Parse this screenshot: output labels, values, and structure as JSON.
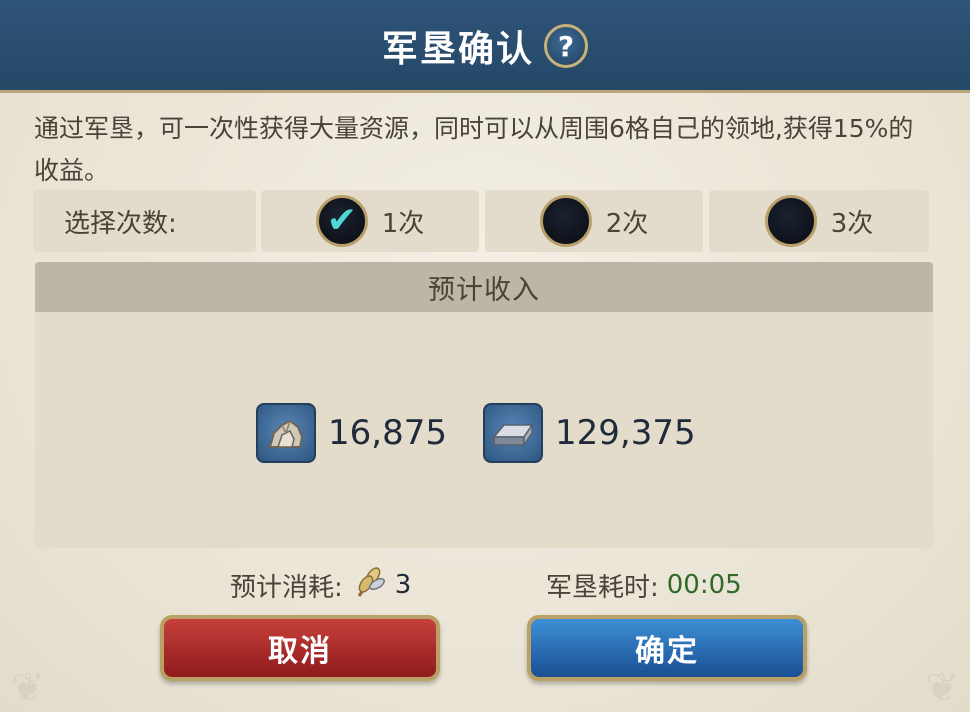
{
  "dialog": {
    "title": "军垦确认",
    "help_glyph": "?",
    "description": "通过军垦，可一次性获得大量资源，同时可以从周围6格自己的领地,获得15%的收益。"
  },
  "selection": {
    "label": "选择次数:",
    "options": [
      {
        "label": "1次",
        "selected": true
      },
      {
        "label": "2次",
        "selected": false
      },
      {
        "label": "3次",
        "selected": false
      }
    ],
    "check_glyph": "✔"
  },
  "income": {
    "header": "预计收入",
    "resources": [
      {
        "icon": "stone-icon",
        "value": "16,875"
      },
      {
        "icon": "iron-ingot-icon",
        "value": "129,375"
      }
    ]
  },
  "cost": {
    "label": "预计消耗:",
    "icon": "wheat-icon",
    "value": "3",
    "time_label": "军垦耗时:",
    "time_value": "00:05"
  },
  "buttons": {
    "cancel": "取消",
    "confirm": "确定"
  },
  "colors": {
    "title_bar": "#2a4e70",
    "cancel": "#b3302e",
    "confirm": "#2566b0",
    "checkmark": "#4fd7d4",
    "time": "#2f6b28"
  }
}
